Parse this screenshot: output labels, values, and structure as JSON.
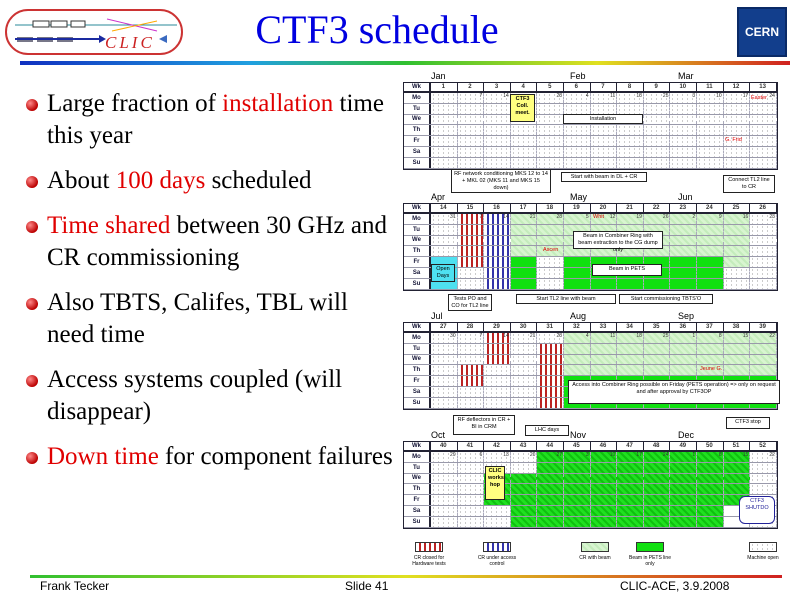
{
  "title": "CTF3 schedule",
  "logos": {
    "left": "CLIC",
    "right": "CERN"
  },
  "bullets": [
    {
      "parts": [
        {
          "t": "Large fraction of ",
          "red": false
        },
        {
          "t": "installation",
          "red": true
        },
        {
          "t": " time this year",
          "red": false
        }
      ]
    },
    {
      "parts": [
        {
          "t": "About ",
          "red": false
        },
        {
          "t": "100 days",
          "red": true
        },
        {
          "t": " scheduled",
          "red": false
        }
      ]
    },
    {
      "parts": [
        {
          "t": "Time shared",
          "red": true
        },
        {
          "t": " between 30 GHz and CR commissioning",
          "red": false
        }
      ]
    },
    {
      "parts": [
        {
          "t": "Also TBTS, Califes, TBL will need time",
          "red": false
        }
      ]
    },
    {
      "parts": [
        {
          "t": "Access systems coupled (will disappear)",
          "red": false
        }
      ]
    },
    {
      "parts": [
        {
          "t": "Down time",
          "red": true
        },
        {
          "t": " for component failures",
          "red": false
        }
      ]
    }
  ],
  "calendar": {
    "day_labels": [
      "Wk",
      "Mo",
      "Tu",
      "We",
      "Th",
      "Fr",
      "Sa",
      "Su"
    ],
    "blocks": [
      {
        "months": [
          "Jan",
          "Feb",
          "Mar"
        ],
        "weeks": [
          "1",
          "2",
          "3",
          "4",
          "5",
          "6",
          "7",
          "8",
          "9",
          "10",
          "11",
          "12",
          "13"
        ],
        "mondays": [
          "",
          "7",
          "14",
          "",
          "28",
          "4",
          "11",
          "18",
          "25",
          "3",
          "10",
          "17",
          "24"
        ],
        "cells": [
          "ddddddd",
          "ddddddd",
          "ddddddd",
          "ddddddd",
          "ddddddd",
          "ddddddd",
          "ddddddd",
          "ddddddd",
          "ddddddd",
          "ddddddd",
          "ddddddd",
          "ddddddd",
          "ddddddd"
        ]
      },
      {
        "months": [
          "Apr",
          "May",
          "Jun"
        ],
        "weeks": [
          "14",
          "15",
          "16",
          "17",
          "18",
          "19",
          "20",
          "21",
          "22",
          "23",
          "24",
          "25",
          "26"
        ],
        "mondays": [
          "31",
          "7",
          "14",
          "21",
          "28",
          "5",
          "12",
          "19",
          "26",
          "2",
          "9",
          "16",
          "23"
        ],
        "cells": [
          "ddddccc",
          "rrrrrdd",
          "bbbbbbb",
          "llllsss",
          "lllldddd",
          "llllsss",
          "llllsss",
          "llllsss",
          "llllsss",
          "llllsss",
          "llllsss",
          "llllldd",
          "ddddddd"
        ]
      },
      {
        "months": [
          "Jul",
          "Aug",
          "Sep"
        ],
        "weeks": [
          "27",
          "28",
          "29",
          "30",
          "31",
          "32",
          "33",
          "34",
          "35",
          "36",
          "37",
          "38",
          "39"
        ],
        "mondays": [
          "30",
          "7",
          "14",
          "21",
          "28",
          "4",
          "11",
          "18",
          "25",
          "1",
          "8",
          "15",
          "22"
        ],
        "cells": [
          "ddddddd",
          "dddrrdd",
          "rrrdddd",
          "ddddddd",
          "drrrrrr",
          "llllsss",
          "llllsss",
          "llllsss",
          "llllsss",
          "llllsss",
          "llllsss",
          "llllsss",
          "llllsss"
        ]
      },
      {
        "months": [
          "Oct",
          "Nov",
          "Dec"
        ],
        "weeks": [
          "40",
          "41",
          "42",
          "43",
          "44",
          "45",
          "46",
          "47",
          "48",
          "49",
          "50",
          "51",
          "52"
        ],
        "mondays": [
          "29",
          "6",
          "13",
          "20",
          "27",
          "3",
          "10",
          "17",
          "24",
          "1",
          "8",
          "15",
          "22"
        ],
        "cells": [
          "ddddddd",
          "ddddddd",
          "ddgggdd",
          "ddggggg",
          "ggggggg",
          "ggggggg",
          "ggggggg",
          "ggggggg",
          "ggggggg",
          "ggggggg",
          "ggggggg",
          "gggggww",
          "ddddddd"
        ]
      }
    ],
    "notes": {
      "ctf3_coll": "CTF3 Coll. meet.",
      "installation": "Installation",
      "easter": "Easter",
      "good_friday": "G. Frid",
      "rf_network": "RF network conditioning MKS 12 to 14 + MKL 02 (MKS 11 and MKS 15 down)",
      "start_beam": "Start with beam in DL + CR",
      "connect_tl2": "Connect TL2 line to CR",
      "whit": "Whit",
      "ascen": "Ascen",
      "beam_cr": "Beam in Combiner Ring with beam extraction to the CG dump only",
      "open_days": "Open Days",
      "beam_pets": "Beam in PETS",
      "tests_po": "Tests PO and CO for TL2 line",
      "start_tl2": "Start TL2 line with beam",
      "start_tbts": "Start commissioning TBTS'O",
      "jeune": "Jeune G.",
      "access": "Access into Combiner Ring possible on Friday (PETS operation) => only on request and after approval by CTF3OP",
      "rf_deflectors": "RF deflectors in CR + BI in CRM",
      "lhc_days": "LHC days",
      "ctf3_stop": "CTF3 stop",
      "clic_workshop": "CLIC works hop",
      "ctf3_shutdown": "CTF3 SHUTDO"
    },
    "legend": [
      {
        "cls": "r",
        "label": "CR closed for Hardware tests"
      },
      {
        "cls": "bl",
        "label": "CR under access control"
      },
      {
        "cls": "l",
        "label": "CR with beam"
      },
      {
        "cls": "gs",
        "label": "Beam in PETS line only"
      },
      {
        "cls": "d",
        "label": "Machine open"
      }
    ]
  },
  "footer": {
    "author": "Frank Tecker",
    "slide": "Slide 41",
    "event": "CLIC-ACE, 3.9.2008"
  }
}
